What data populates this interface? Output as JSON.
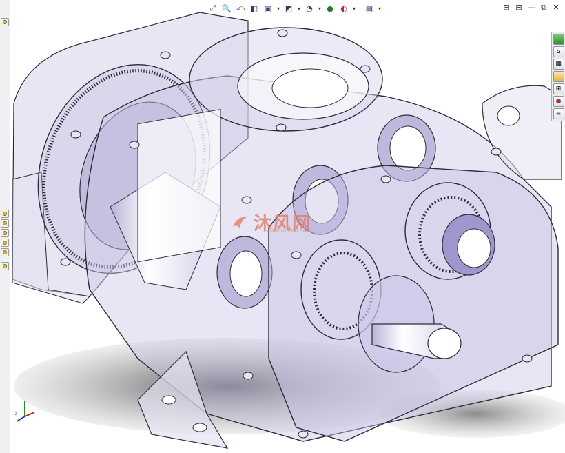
{
  "toolbar": {
    "buttons": [
      {
        "name": "zoom-to-fit-icon",
        "glyph": "⤢"
      },
      {
        "name": "zoom-area-icon",
        "glyph": "🔍"
      },
      {
        "name": "previous-view-icon",
        "glyph": "⤺"
      },
      {
        "name": "section-view-icon",
        "glyph": "◧"
      },
      {
        "name": "view-orientation-icon",
        "glyph": "▣"
      },
      {
        "name": "display-style-icon",
        "glyph": "◩"
      },
      {
        "name": "hide-show-items-icon",
        "glyph": "◔"
      },
      {
        "name": "edit-appearance-icon",
        "glyph": "●"
      },
      {
        "name": "apply-scene-icon",
        "glyph": "◐"
      },
      {
        "name": "view-settings-icon",
        "glyph": "▤"
      }
    ]
  },
  "window_controls": [
    "⊟",
    "⊟",
    "—",
    "⧉",
    "✕"
  ],
  "task_pane": {
    "tabs": [
      "solidworks-resources-icon",
      "design-library-icon",
      "file-explorer-icon",
      "view-palette-icon",
      "appearances-icon",
      "custom-properties-icon",
      "home-icon"
    ]
  },
  "watermark": {
    "text": "沐风网",
    "url": "www.mfcad.com"
  },
  "colors": {
    "part_fill": "#c9c4e3",
    "edge": "#2c2c38",
    "shadow": "#6e6e70"
  }
}
